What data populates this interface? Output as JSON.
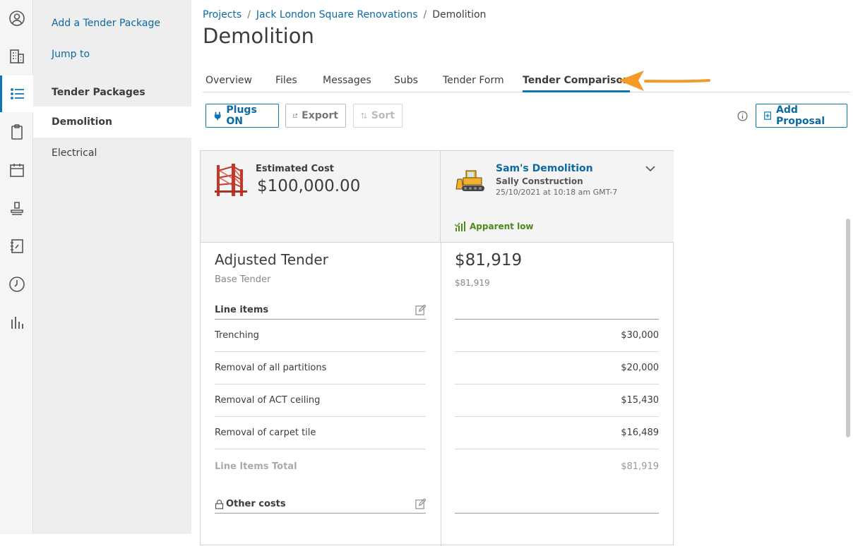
{
  "rail": {
    "icons": [
      "user-circle-icon",
      "building-icon",
      "list-icon",
      "clipboard-icon",
      "calendar-icon",
      "stamp-icon",
      "notebook-icon",
      "clock-icon",
      "bar-chart-icon"
    ],
    "active_color": "#0b77b4"
  },
  "sidebar": {
    "add_link": "Add a Tender Package",
    "jump_link": "Jump to",
    "heading": "Tender Packages",
    "items": [
      {
        "label": "Demolition"
      },
      {
        "label": "Electrical"
      }
    ]
  },
  "breadcrumb": {
    "projects": "Projects",
    "sep": "/",
    "project": "Jack London Square Renovations",
    "current": "Demolition"
  },
  "page": {
    "title": "Demolition"
  },
  "tabs": [
    {
      "label": "Overview"
    },
    {
      "label": "Files"
    },
    {
      "label": "Messages"
    },
    {
      "label": "Subs"
    },
    {
      "label": "Tender Form"
    },
    {
      "label": "Tender Comparison"
    }
  ],
  "toolbar": {
    "plugs": "Plugs ON",
    "export": "Export",
    "sort": "Sort",
    "add_proposal": "Add Proposal"
  },
  "estimate": {
    "label": "Estimated Cost",
    "value": "$100,000.00"
  },
  "bidder": {
    "name": "Sam's Demolition",
    "company": "Sally Construction",
    "date": "25/10/2021 at 10:18 am GMT-7",
    "badge": "Apparent low",
    "total": "$81,919",
    "base": "$81,919"
  },
  "tender": {
    "title": "Adjusted Tender",
    "subtitle": "Base Tender",
    "line_items_header": "Line items",
    "other_costs_header": "Other costs",
    "total_label": "Line Items Total",
    "total_value": "$81,919",
    "rows": [
      {
        "label": "Trenching",
        "value": "$30,000"
      },
      {
        "label": "Removal of all partitions",
        "value": "$20,000"
      },
      {
        "label": "Removal of ACT ceiling",
        "value": "$15,430"
      },
      {
        "label": "Removal of carpet tile",
        "value": "$16,489"
      }
    ]
  },
  "colors": {
    "accent": "#0b77b4",
    "highlight_arrow": "#f39a2b",
    "low_badge": "#4d8a1a"
  }
}
